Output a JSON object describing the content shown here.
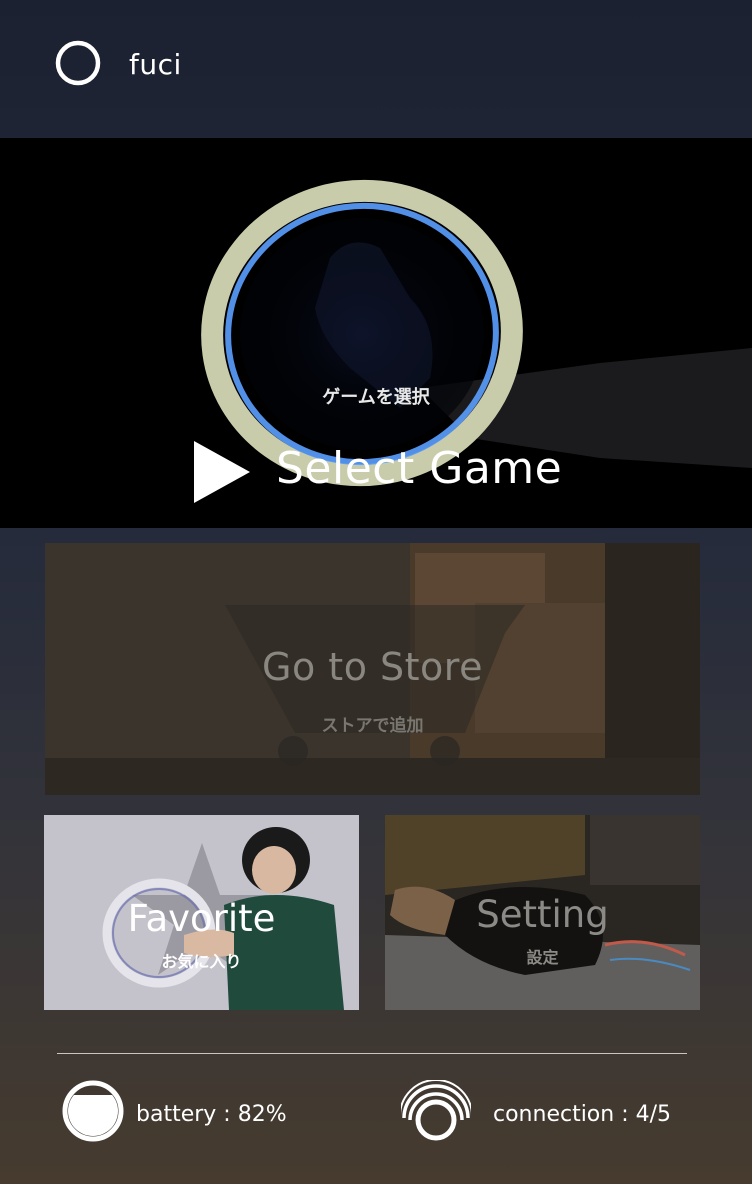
{
  "header": {
    "app_name": "fuci",
    "logo_icon": "ring-logo-icon"
  },
  "menu": {
    "select_game": {
      "title": "Select Game",
      "subtitle": "ゲームを選択",
      "icon": "play-icon"
    },
    "store": {
      "title": "Go to Store",
      "subtitle": "ストアで追加"
    },
    "favorite": {
      "title": "Favorite",
      "subtitle": "お気に入り"
    },
    "setting": {
      "title": "Setting",
      "subtitle": "設定"
    }
  },
  "status": {
    "battery_text": "battery : 82%",
    "battery_level": 0.82,
    "connection_text": "connection : 4/5",
    "connection_value": 4,
    "connection_max": 5
  },
  "colors": {
    "ring_glow": "#5aa0ff",
    "ring_tape": "#cfd2b2",
    "text_primary": "#ffffff",
    "text_muted": "#8a8680"
  }
}
